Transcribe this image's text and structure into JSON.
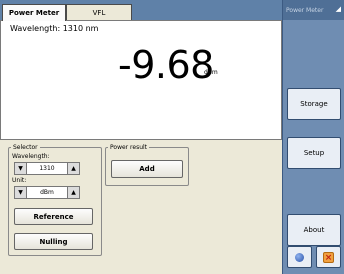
{
  "tabs": [
    {
      "label": "Power Meter",
      "active": true
    },
    {
      "label": "VFL",
      "active": false
    }
  ],
  "display": {
    "wavelength_text": "Wavelength: 1310 nm",
    "power_value": "-9.68",
    "power_unit": "dBm"
  },
  "selector": {
    "legend": "Selector",
    "wavelength_label": "Wavelength:",
    "wavelength_value": "1310",
    "unit_label": "Unit:",
    "unit_value": "dBm",
    "reference_label": "Reference",
    "nulling_label": "Nulling"
  },
  "power_result": {
    "legend": "Power result",
    "add_label": "Add"
  },
  "sidebar": {
    "title": "Power Meter",
    "storage_label": "Storage",
    "setup_label": "Setup",
    "about_label": "About"
  },
  "icons": {
    "down": "down-arrow-icon",
    "up": "up-arrow-icon",
    "help": "globe-icon",
    "close": "close-icon"
  },
  "colors": {
    "header_blue": "#5f81a8",
    "sidebar_blue": "#6f8db2",
    "close_orange": "#f0a040"
  }
}
